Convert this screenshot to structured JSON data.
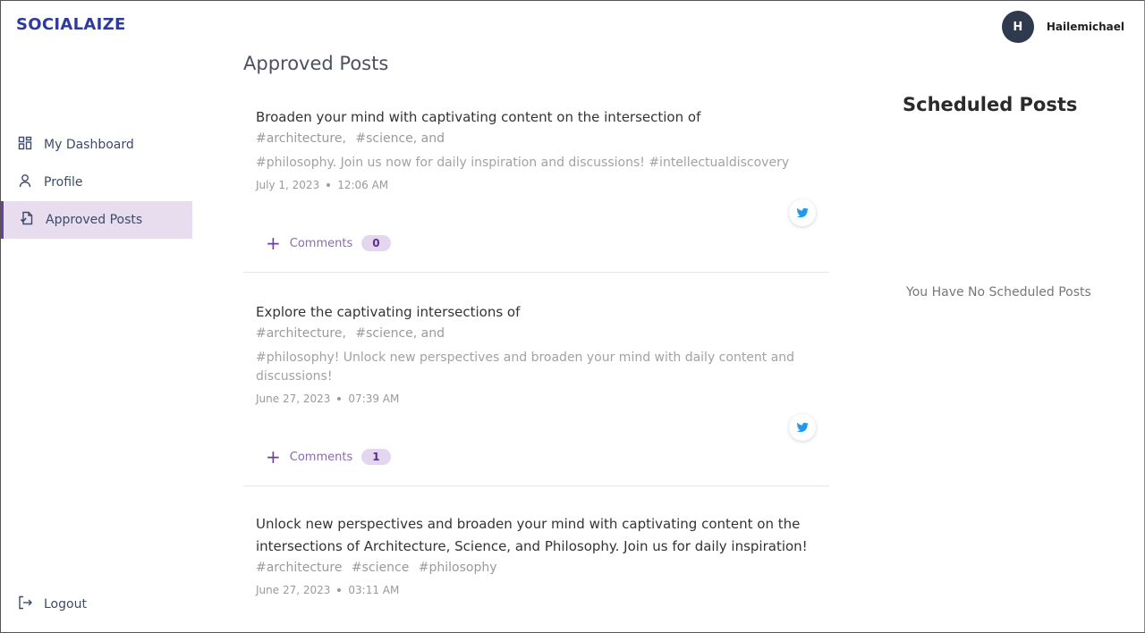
{
  "brand": {
    "name": "SOCIALAIZE",
    "color": "#2f3b9a"
  },
  "user": {
    "initial": "H",
    "name": "Hailemichael"
  },
  "sidebar": {
    "items": [
      {
        "label": "My Dashboard",
        "icon": "dashboard-grid-icon"
      },
      {
        "label": "Profile",
        "icon": "person-icon"
      },
      {
        "label": "Approved Posts",
        "icon": "approved-document-icon",
        "active": true
      }
    ],
    "logout": {
      "label": "Logout",
      "icon": "logout-icon"
    }
  },
  "main": {
    "title": "Approved Posts",
    "posts": [
      {
        "text": "Broaden your mind with captivating content on the intersection of",
        "tags": [
          "#architecture,",
          "#science, and"
        ],
        "body": "#philosophy. Join us now for daily inspiration and discussions!  #intellectualdiscovery",
        "date": "July 1, 2023",
        "time": "12:06 AM",
        "platform": "twitter-icon",
        "comments_label": "Comments",
        "comments_count": "0"
      },
      {
        "text": "Explore the captivating intersections of",
        "tags": [
          "#architecture,",
          "#science, and"
        ],
        "body": "#philosophy! Unlock new perspectives and broaden your mind with daily content and discussions!",
        "date": "June 27, 2023",
        "time": "07:39 AM",
        "platform": "twitter-icon",
        "comments_label": "Comments",
        "comments_count": "1"
      },
      {
        "text": "Unlock new perspectives and broaden your mind with captivating content on the intersections of Architecture, Science, and Philosophy. Join us for daily inspiration!",
        "tags": [
          "#architecture",
          "#science",
          "#philosophy"
        ],
        "date": "June 27, 2023",
        "time": "03:11 AM"
      }
    ]
  },
  "scheduled": {
    "title": "Scheduled Posts",
    "empty_message": "You Have No Scheduled Posts"
  },
  "colors": {
    "accent": "#6b3fa0",
    "active_bg": "#e8dcef",
    "twitter": "#1d9bf0"
  }
}
